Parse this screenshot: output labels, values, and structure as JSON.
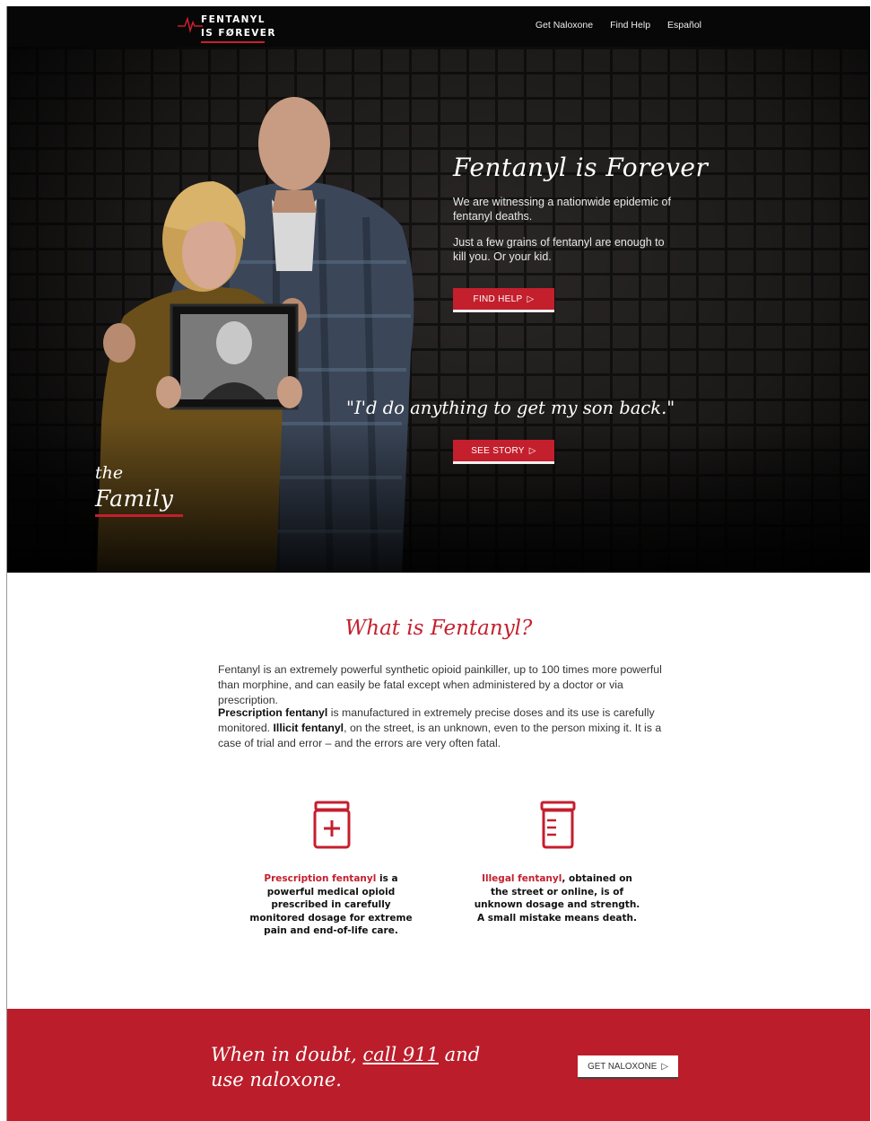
{
  "nav": {
    "logo_line1": "FENTANYL",
    "logo_line2": "IS FØREVER",
    "links": [
      "Get Naloxone",
      "Find Help",
      "Español"
    ]
  },
  "hero": {
    "title": "Fentanyl is Forever",
    "paragraph1": "We are witnessing a nationwide epidemic of fentanyl deaths.",
    "paragraph2": "Just a few grains of fentanyl are enough to kill you. Or your kid.",
    "find_help_button": "FIND HELP",
    "quote": "\"I'd do anything to get my son back.\"",
    "see_story_button": "SEE STORY",
    "story_label_small": "the",
    "story_label_big": "Family"
  },
  "what": {
    "title": "What is Fentanyl?",
    "paragraph1": "Fentanyl is an extremely powerful synthetic opioid painkiller, up to 100 times more powerful than morphine, and can easily be fatal except when administered by a doctor or via prescription.",
    "p2_bold1": "Prescription fentanyl",
    "p2_text1": " is manufactured in extremely precise doses and its use is carefully monitored. ",
    "p2_bold2": "Illicit fentanyl",
    "p2_text2": ", on the street, is an unknown, even to the person mixing it. It is a case of trial and error – and the errors are very often fatal."
  },
  "cards": [
    {
      "icon": "prescription-bottle-icon",
      "highlight": "Prescription fentanyl",
      "text": " is a powerful medical opioid prescribed in carefully monitored dosage for extreme pain and end-of-life care."
    },
    {
      "icon": "pill-bottle-icon",
      "highlight": "Illegal fentanyl",
      "text": ", obtained on the street or online, is of unknown dosage and strength. A small mistake means death."
    }
  ],
  "band": {
    "text1": "When in doubt, ",
    "link": "call 911",
    "text2": " and use naloxone.",
    "button": "GET NALOXONE"
  },
  "colors": {
    "brand_red": "#c41f2d",
    "nav_bg": "#070707",
    "band_red": "#bb1d2a"
  }
}
